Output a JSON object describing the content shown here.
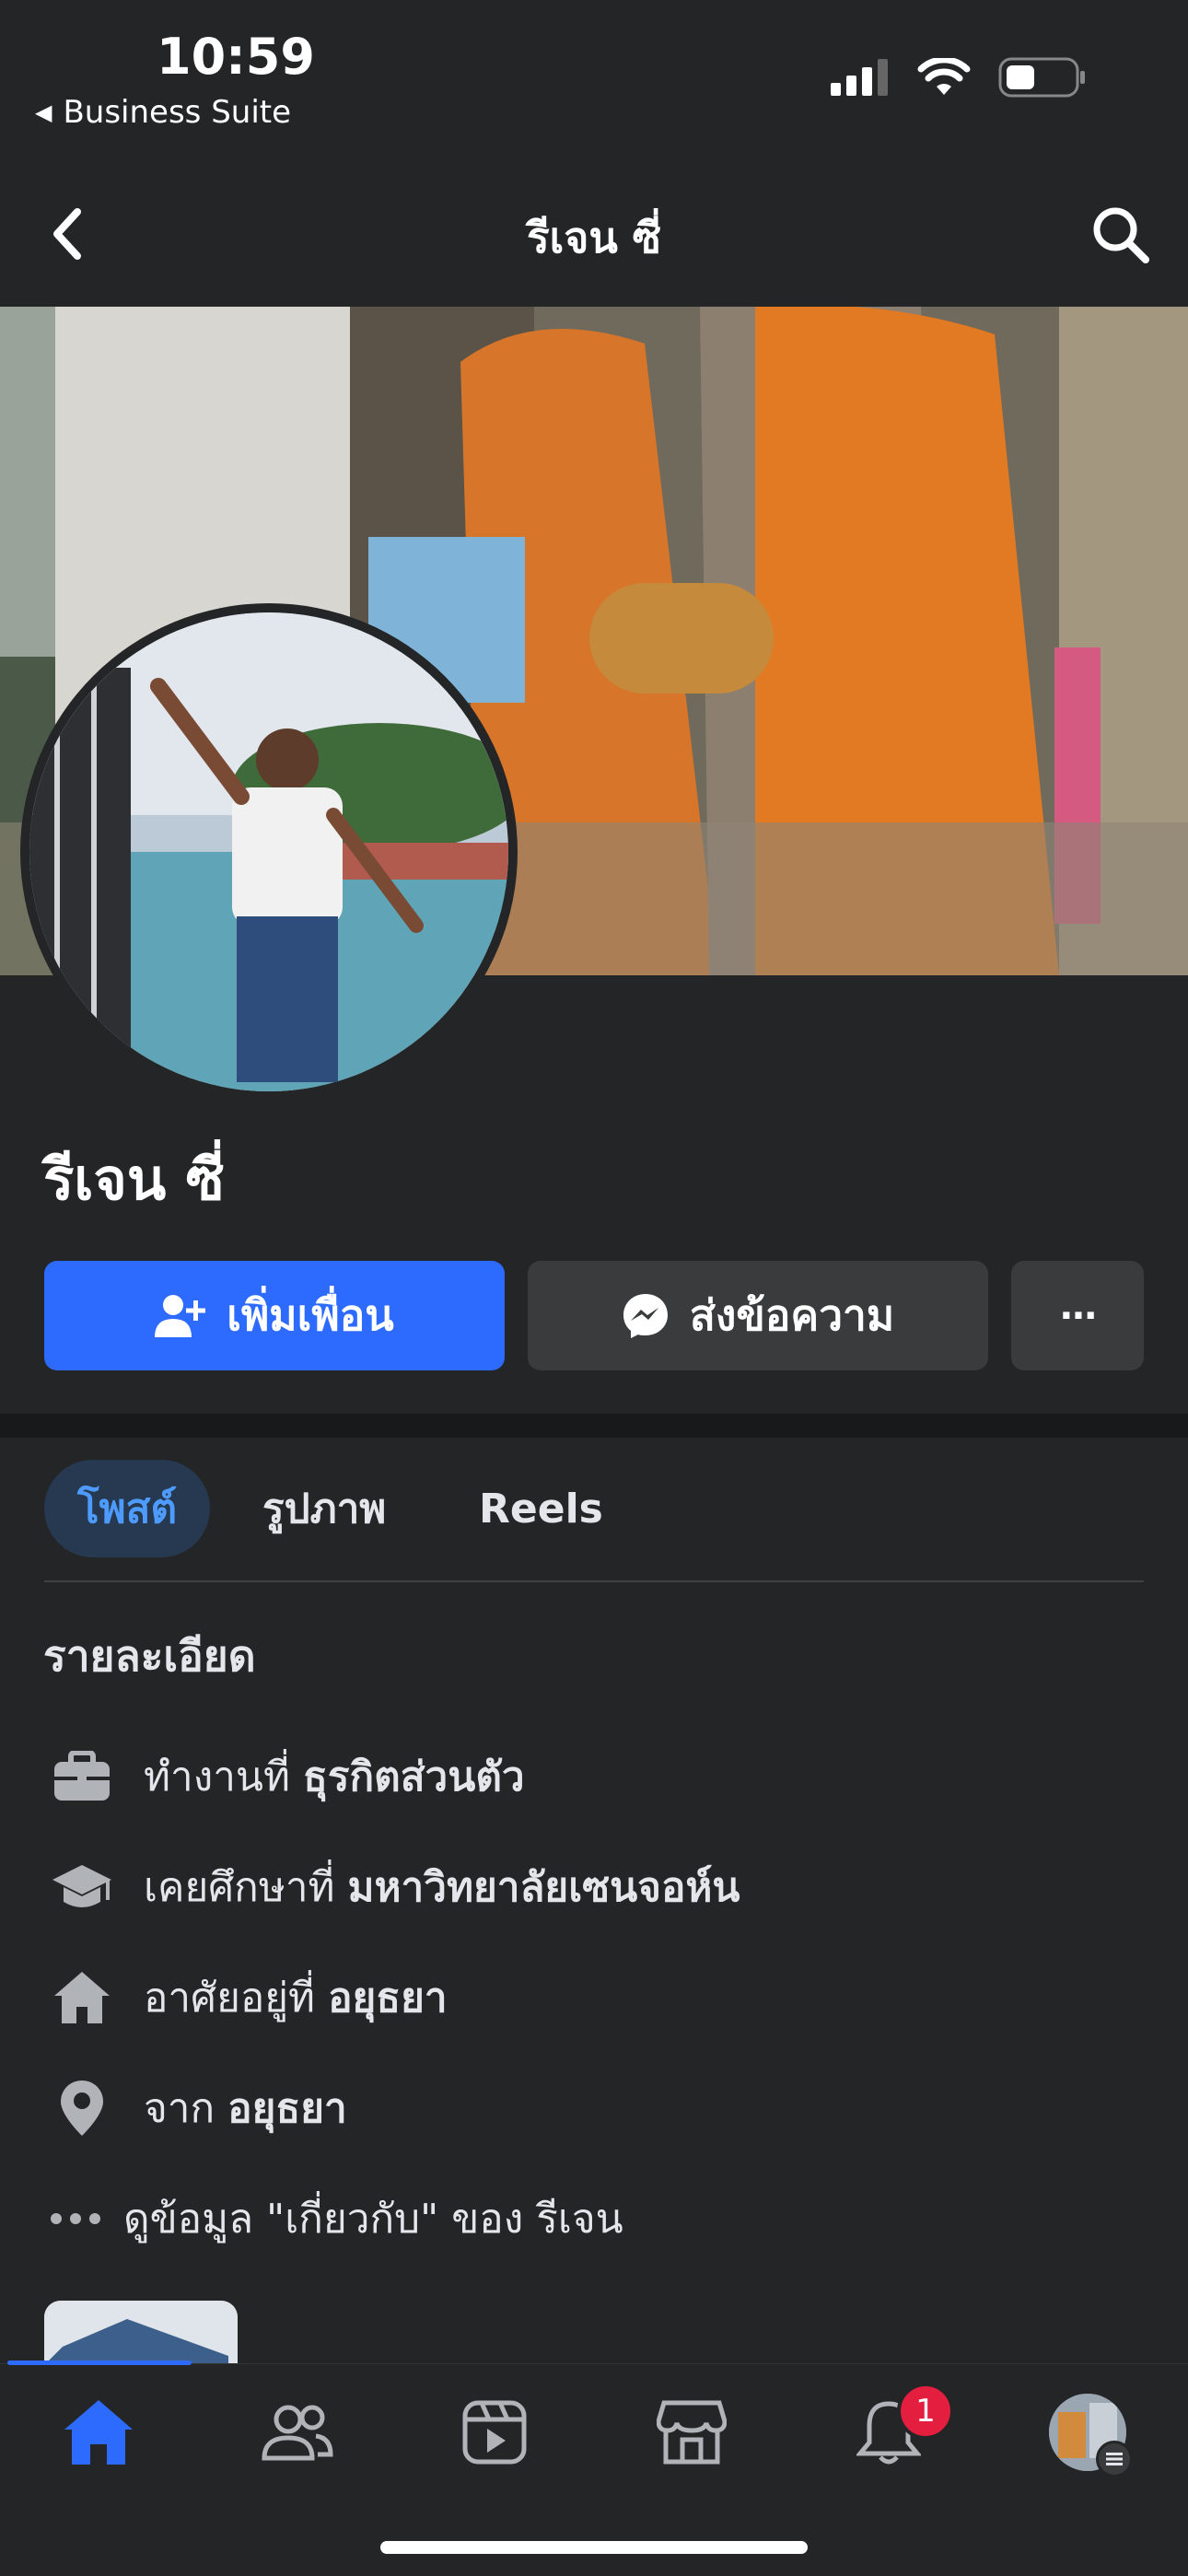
{
  "status_bar": {
    "time": "10:59",
    "back_app": "Business Suite"
  },
  "nav": {
    "title": "รีเจน ซี่"
  },
  "profile": {
    "name": "รีเจน ซี่"
  },
  "actions": {
    "add_friend": "เพิ่มเพื่อน",
    "message": "ส่งข้อความ",
    "more": "···"
  },
  "tabs": [
    {
      "label": "โพสต์"
    },
    {
      "label": "รูปภาพ"
    },
    {
      "label": "Reels"
    }
  ],
  "details": {
    "heading": "รายละเอียด",
    "items": [
      {
        "icon": "briefcase-icon",
        "prefix": "ทำงานที่",
        "value": "ธุรกิตส่วนตัว"
      },
      {
        "icon": "graduation-cap-icon",
        "prefix": "เคยศึกษาที่",
        "value": "มหาวิทยาลัยเซนจอห์น"
      },
      {
        "icon": "home-icon",
        "prefix": "อาศัยอยู่ที่",
        "value": "อยุธยา"
      },
      {
        "icon": "location-pin-icon",
        "prefix": "จาก",
        "value": "อยุธยา"
      }
    ],
    "see_about": "ดูข้อมูล \"เกี่ยวกับ\" ของ รีเจน"
  },
  "bottom_bar": {
    "notifications_badge": "1"
  },
  "colors": {
    "accent": "#2d6bff",
    "background": "#242526",
    "secondary_button": "#3a3b3c",
    "badge": "#e41e3f"
  }
}
